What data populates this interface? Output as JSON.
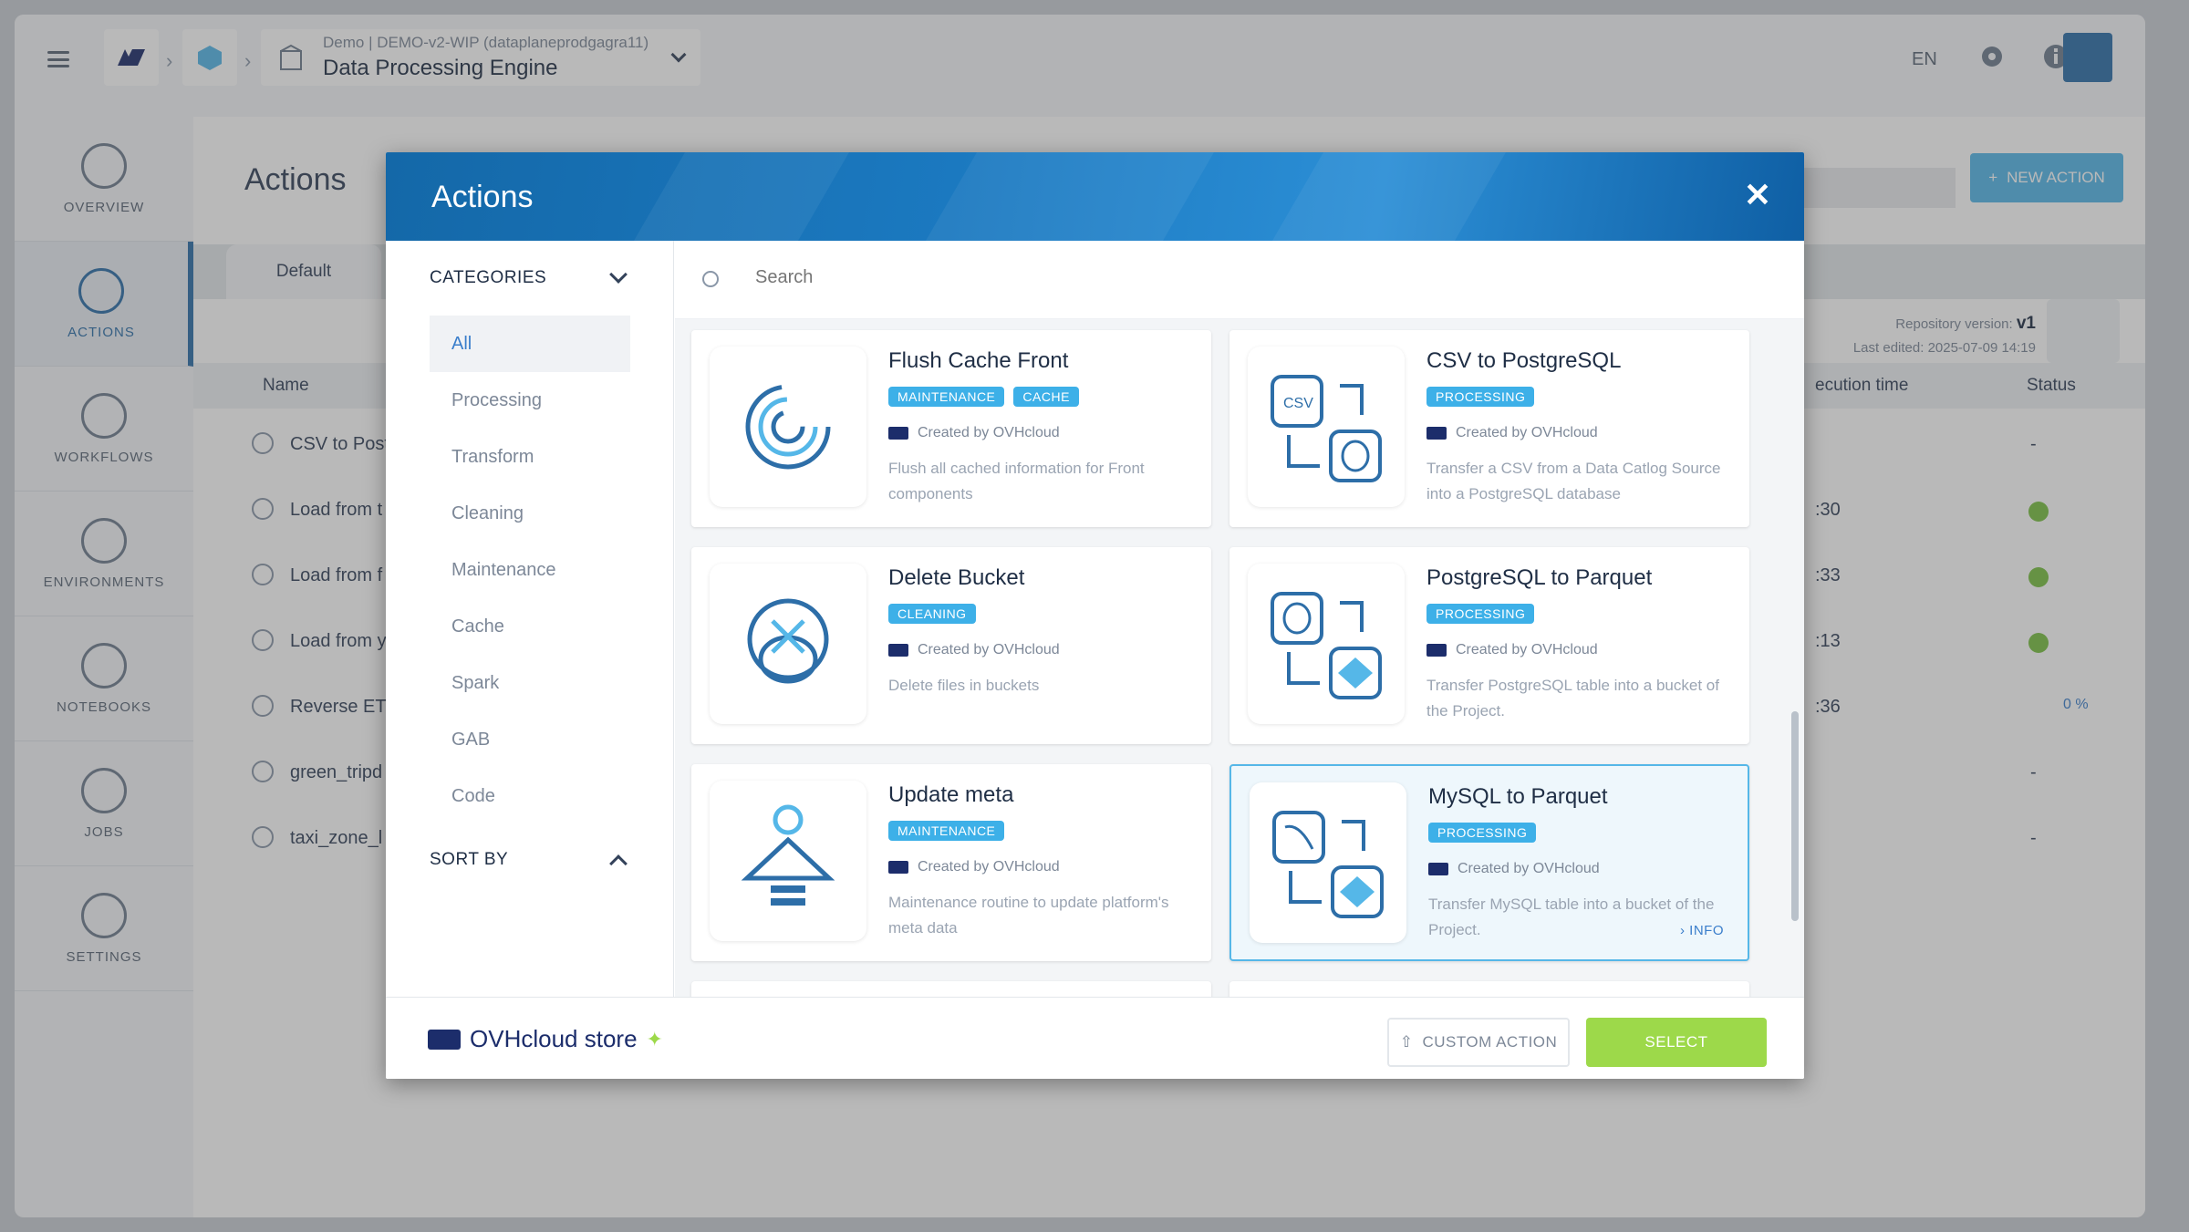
{
  "topbar": {
    "breadcrumb_sub": "Demo | DEMO-v2-WIP (dataplaneprodgagra11)",
    "breadcrumb_main": "Data Processing Engine",
    "lang": "EN"
  },
  "sidebar": {
    "items": [
      {
        "label": "OVERVIEW"
      },
      {
        "label": "ACTIONS"
      },
      {
        "label": "WORKFLOWS"
      },
      {
        "label": "ENVIRONMENTS"
      },
      {
        "label": "NOTEBOOKS"
      },
      {
        "label": "JOBS"
      },
      {
        "label": "SETTINGS"
      }
    ]
  },
  "page": {
    "title": "Actions",
    "new_action": "NEW ACTION",
    "tab_default": "Default",
    "repo_version_label": "Repository version:",
    "repo_version": "v1",
    "last_edited_label": "Last edited:",
    "last_edited": "2025-07-09 14:19",
    "columns": {
      "name": "Name",
      "exec": "ecution time",
      "status": "Status"
    },
    "rows": [
      {
        "name": "CSV to Post",
        "exec": "",
        "status": "-"
      },
      {
        "name": "Load from t",
        "exec": ":30",
        "status": ""
      },
      {
        "name": "Load from f",
        "exec": ":33",
        "status": ""
      },
      {
        "name": "Load from y",
        "exec": ":13",
        "status": ""
      },
      {
        "name": "Reverse ET",
        "exec": ":36",
        "status": "0 %"
      },
      {
        "name": "green_tripd",
        "exec": "",
        "status": "-"
      },
      {
        "name": "taxi_zone_l",
        "exec": "",
        "status": "-"
      }
    ]
  },
  "modal": {
    "title": "Actions",
    "categories_label": "CATEGORIES",
    "categories": [
      "All",
      "Processing",
      "Transform",
      "Cleaning",
      "Maintenance",
      "Cache",
      "Spark",
      "GAB",
      "Code"
    ],
    "sort_by_label": "SORT BY",
    "search_placeholder": "Search",
    "cards": [
      {
        "title": "Flush Cache Front",
        "tags": [
          "MAINTENANCE",
          "CACHE"
        ],
        "by": "Created by OVHcloud",
        "desc": "Flush all cached information for Front components",
        "icon": "spiral-icon"
      },
      {
        "title": "CSV to PostgreSQL",
        "tags": [
          "PROCESSING"
        ],
        "by": "Created by OVHcloud",
        "desc": "Transfer a CSV from a Data Catlog Source into a PostgreSQL database",
        "icon": "csv-to-postgres-icon"
      },
      {
        "title": "Delete Bucket",
        "tags": [
          "CLEANING"
        ],
        "by": "Created by OVHcloud",
        "desc": "Delete files in buckets",
        "icon": "delete-bucket-icon"
      },
      {
        "title": "PostgreSQL to Parquet",
        "tags": [
          "PROCESSING"
        ],
        "by": "Created by OVHcloud",
        "desc": "Transfer PostgreSQL table into a bucket of the Project.",
        "icon": "postgres-to-parquet-icon"
      },
      {
        "title": "Update meta",
        "tags": [
          "MAINTENANCE"
        ],
        "by": "Created by OVHcloud",
        "desc": "Maintenance routine to update platform's meta data",
        "icon": "upload-arrow-icon"
      },
      {
        "title": "MySQL to Parquet",
        "tags": [
          "PROCESSING"
        ],
        "by": "Created by OVHcloud",
        "desc": "Transfer MySQL table into a bucket of the Project.",
        "icon": "mysql-to-parquet-icon",
        "info": "INFO"
      }
    ],
    "brand": "OVHcloud store",
    "custom_action": "CUSTOM ACTION",
    "select": "SELECT"
  }
}
